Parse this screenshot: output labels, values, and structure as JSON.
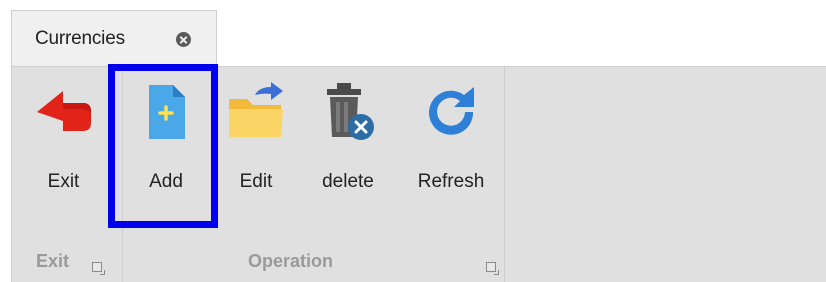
{
  "tab": {
    "label": "Currencies",
    "close_icon": "close-circle-icon"
  },
  "ribbon": {
    "groups": [
      {
        "label": "Exit"
      },
      {
        "label": "Operation"
      }
    ],
    "buttons": [
      {
        "label": "Exit",
        "icon": "exit-arrow-icon"
      },
      {
        "label": "Add",
        "icon": "add-document-icon"
      },
      {
        "label": "Edit",
        "icon": "edit-folder-icon"
      },
      {
        "label": "delete",
        "icon": "delete-trash-icon"
      },
      {
        "label": "Refresh",
        "icon": "refresh-icon"
      }
    ]
  },
  "colors": {
    "highlight": "#0000ee",
    "exit_icon": "#e2231a",
    "add_icon": "#4aa8e8",
    "edit_icon": "#f5c64a",
    "refresh_icon": "#2e7fd8"
  }
}
